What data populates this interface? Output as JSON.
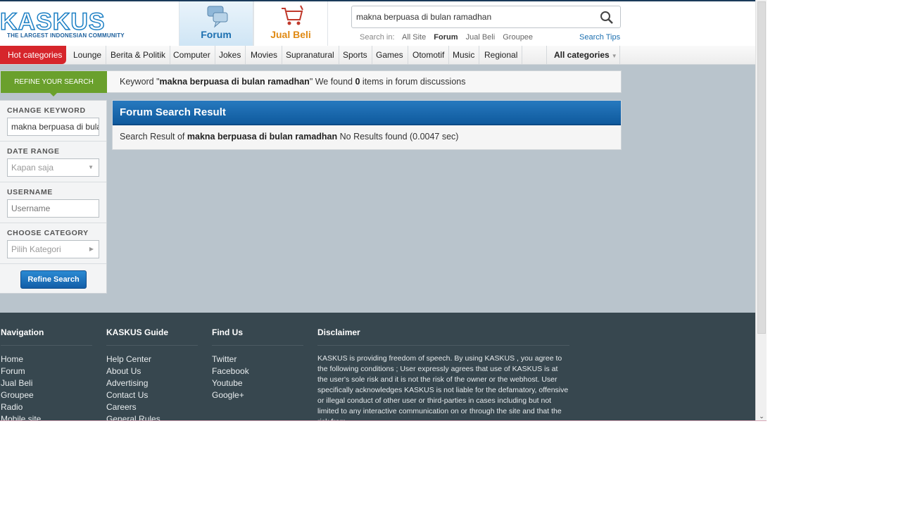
{
  "header": {
    "logo_text": "KASKUS",
    "logo_tagline": "THE LARGEST INDONESIAN COMMUNITY",
    "nav": [
      {
        "label": "Forum"
      },
      {
        "label": "Jual Beli"
      }
    ],
    "search": {
      "value": "makna berpuasa di bulan ramadhan",
      "search_in_label": "Search in:",
      "options": [
        "All Site",
        "Forum",
        "Jual Beli",
        "Groupee"
      ],
      "selected": "Forum",
      "tips": "Search Tips"
    }
  },
  "categories": {
    "hot": "Hot categories",
    "items": [
      "Lounge",
      "Berita & Politik",
      "Computer",
      "Jokes",
      "Movies",
      "Supranatural",
      "Sports",
      "Games",
      "Otomotif",
      "Music",
      "Regional"
    ],
    "all": "All categories"
  },
  "refine_bar": {
    "tab": "REFINE YOUR SEARCH",
    "msg_prefix": "Keyword \"",
    "keyword": "makna berpuasa di bulan ramadhan",
    "msg_mid": "\" We found ",
    "count": "0",
    "msg_suffix": " items in forum discussions"
  },
  "sidebar": {
    "change_keyword": {
      "title": "CHANGE KEYWORD",
      "value": "makna berpuasa di bulan ramadhan"
    },
    "date_range": {
      "title": "DATE RANGE",
      "value": "Kapan saja"
    },
    "username": {
      "title": "USERNAME",
      "placeholder": "Username"
    },
    "category": {
      "title": "CHOOSE CATEGORY",
      "value": "Pilih Kategori"
    },
    "button": "Refine Search"
  },
  "result": {
    "title": "Forum Search Result",
    "prefix": "Search Result of ",
    "keyword": "makna berpuasa di bulan ramadhan",
    "suffix": " No Results found (0.0047 sec)"
  },
  "footer": {
    "navigation": {
      "title": "Navigation",
      "items": [
        "Home",
        "Forum",
        "Jual Beli",
        "Groupee",
        "Radio",
        "Mobile site"
      ]
    },
    "guide": {
      "title": "KASKUS Guide",
      "items": [
        "Help Center",
        "About Us",
        "Advertising",
        "Contact Us",
        "Careers",
        "General Rules"
      ]
    },
    "findus": {
      "title": "Find Us",
      "items": [
        "Twitter",
        "Facebook",
        "Youtube",
        "Google+"
      ]
    },
    "disclaimer": {
      "title": "Disclaimer",
      "text": "KASKUS is providing freedom of speech. By using KASKUS , you agree to the following conditions ; User expressly agrees that use of KASKUS is at the user's sole risk and it is not the risk of the owner or the webhost. User specifically acknowledges KASKUS is not liable for the defamatory, offensive or illegal conduct of other user or third-parties in cases including but not limited to any interactive communication on or through the site and that the risk from"
    }
  },
  "colors": {
    "brand_blue": "#1c7fc4",
    "hot_red": "#d6252b",
    "refine_green": "#6aa02c",
    "footer_bg": "#37474f"
  }
}
